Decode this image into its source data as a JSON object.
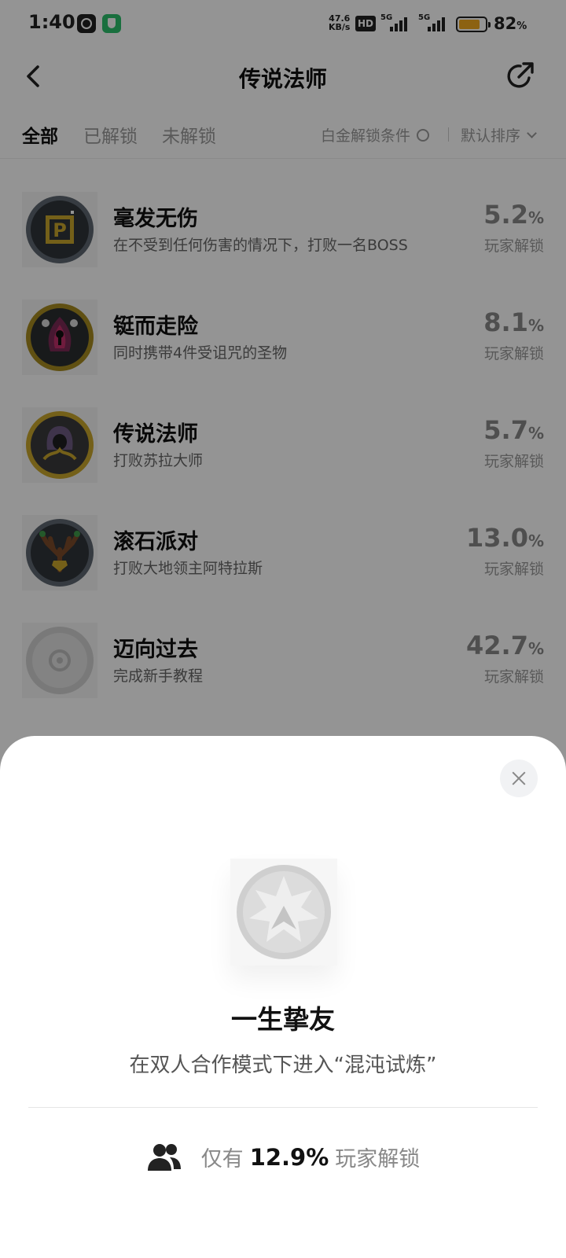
{
  "status_bar": {
    "time": "1:40",
    "net_speed_value": "47.6",
    "net_speed_unit": "KB/s",
    "hd_label": "HD",
    "sim1_network": "5G",
    "sim2_network": "5G",
    "battery_percent": "82",
    "battery_level": 0.82,
    "battery_color": "#f2a91f"
  },
  "header": {
    "title": "传说法师",
    "back_icon": "chevron-left-icon",
    "share_icon": "share-arrow-icon"
  },
  "tabs": {
    "items": [
      "全部",
      "已解锁",
      "未解锁"
    ],
    "active_index": 0,
    "filter_label": "白金解锁条件",
    "sort_label": "默认排序"
  },
  "achievements": [
    {
      "name": "毫发无伤",
      "desc": "在不受到任何伤害的情况下，打败一名BOSS",
      "pct": "5.2",
      "unlock_label": "玩家解锁",
      "icon": "gold-p-block-icon"
    },
    {
      "name": "铤而走险",
      "desc": "同时携带4件受诅咒的圣物",
      "pct": "8.1",
      "unlock_label": "玩家解锁",
      "icon": "cursed-flame-icon"
    },
    {
      "name": "传说法师",
      "desc": "打败苏拉大师",
      "pct": "5.7",
      "unlock_label": "玩家解锁",
      "icon": "hooded-mage-icon"
    },
    {
      "name": "滚石派对",
      "desc": "打败大地领主阿特拉斯",
      "pct": "13.0",
      "unlock_label": "玩家解锁",
      "icon": "tree-earth-lord-icon"
    },
    {
      "name": "迈向过去",
      "desc": "完成新手教程",
      "pct": "42.7",
      "unlock_label": "玩家解锁",
      "icon": "gray-coin-icon"
    }
  ],
  "percent_sign": "%",
  "sheet": {
    "title": "一生挚友",
    "desc": "在双人合作模式下进入“混沌试炼”",
    "stat_prefix": "仅有",
    "stat_pct": "12.9%",
    "stat_suffix": "玩家解锁",
    "badge_icon": "gray-star-burst-icon",
    "close_icon": "close-icon",
    "users_icon": "users-icon"
  },
  "colors": {
    "overlay": "rgba(0,0,0,0.42)",
    "text_primary": "#111111",
    "text_secondary": "#666666",
    "gold": "#c9a52b"
  }
}
